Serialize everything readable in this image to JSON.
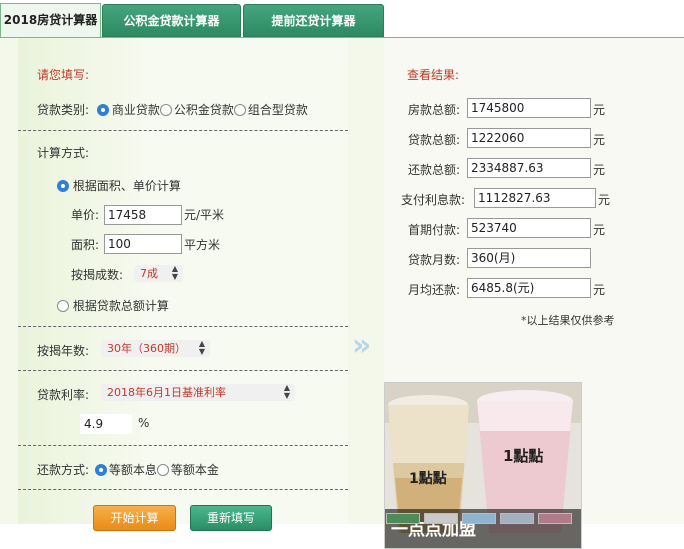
{
  "tabs": [
    {
      "label": "2018房贷计算器"
    },
    {
      "label": "公积金贷款计算器"
    },
    {
      "label": "提前还贷计算器"
    }
  ],
  "left": {
    "fill_title": "请您填写:",
    "loan_type_label": "贷款类别:",
    "loan_types": [
      "商业贷款",
      "公积金贷款",
      "组合型贷款"
    ],
    "calc_method_label": "计算方式:",
    "by_area_label": "根据面积、单价计算",
    "unit_price_label": "单价:",
    "unit_price_value": "17458",
    "unit_price_unit": "元/平米",
    "area_label": "面积:",
    "area_value": "100",
    "area_unit": "平方米",
    "ratio_label": "按揭成数:",
    "ratio_value": "7成",
    "by_total_label": "根据贷款总额计算",
    "years_label": "按揭年数:",
    "years_value": "30年（360期）",
    "rate_label": "贷款利率:",
    "rate_value": "2018年6月1日基准利率",
    "rate_number": "4.9",
    "rate_unit": "%",
    "repay_label": "还款方式:",
    "repay_options": [
      "等额本息",
      "等额本金"
    ],
    "start_button": "开始计算",
    "reset_button": "重新填写"
  },
  "right": {
    "result_title": "查看结果:",
    "rows": [
      {
        "label": "房款总额:",
        "value": "1745800",
        "unit": "元"
      },
      {
        "label": "贷款总额:",
        "value": "1222060",
        "unit": "元"
      },
      {
        "label": "还款总额:",
        "value": "2334887.63",
        "unit": "元"
      },
      {
        "label": "支付利息款:",
        "value": "1112827.63",
        "unit": "元"
      },
      {
        "label": "首期付款:",
        "value": "523740",
        "unit": "元"
      },
      {
        "label": "贷款月数:",
        "value": "360(月)",
        "unit": ""
      },
      {
        "label": "月均还款:",
        "value": "6485.8(元)",
        "unit": "元"
      }
    ],
    "note": "*以上结果仅供参考",
    "ad_caption": "一点点加盟",
    "cup_brand": "1點點"
  },
  "colors": {
    "accent_red": "#c0392b",
    "tab_green": "#2d8a62",
    "panel_bg": "#f3f8ea",
    "radio_blue": "#2f7fd6"
  }
}
